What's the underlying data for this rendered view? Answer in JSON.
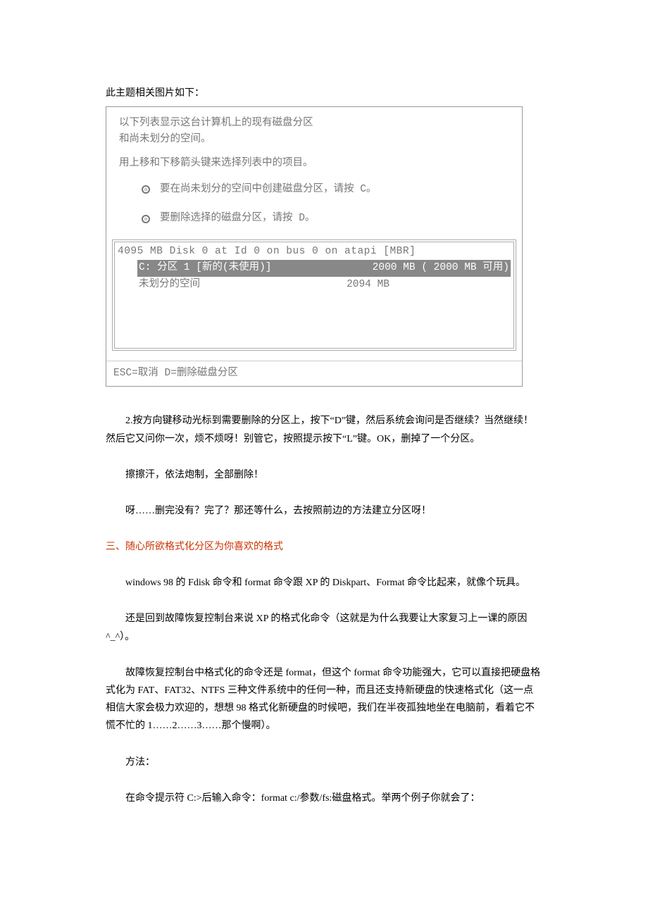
{
  "caption": "此主题相关图片如下：",
  "screenshot": {
    "intro_line1": "以下列表显示这台计算机上的现有磁盘分区",
    "intro_line2": "和尚未划分的空间。",
    "instruction": "用上移和下移箭头键来选择列表中的项目。",
    "bullets": [
      "要在尚未划分的空间中创建磁盘分区，请按 C。",
      "要删除选择的磁盘分区，请按 D。"
    ],
    "disk_header": "4095 MB Disk 0 at Id 0 on bus 0 on atapi [MBR]",
    "selected_left": "C:  分区 1 [新的(未使用)]",
    "selected_right": "2000 MB (  2000 MB 可用)",
    "free_left": "未划分的空间",
    "free_right": "2094 MB",
    "footer": "ESC=取消  D=删除磁盘分区"
  },
  "paragraphs": {
    "p1": "2.按方向键移动光标到需要删除的分区上，按下“D”键，然后系统会询问是否继续？当然继续！然后它又问你一次，烦不烦呀！别管它，按照提示按下“L”键。OK，删掉了一个分区。",
    "p2": "擦擦汗，依法炮制，全部删除！",
    "p3": "呀……删完没有？完了？那还等什么，去按照前边的方法建立分区呀！",
    "section": "三、随心所欲格式化分区为你喜欢的格式",
    "p4": "windows 98 的 Fdisk 命令和 format 命令跟 XP 的 Diskpart、Format 命令比起来，就像个玩具。",
    "p5": "还是回到故障恢复控制台来说 XP 的格式化命令（这就是为什么我要让大家复习上一课的原因^_^）。",
    "p6": "故障恢复控制台中格式化的命令还是 format，但这个 format 命令功能强大，它可以直接把硬盘格式化为 FAT、FAT32、NTFS 三种文件系统中的任何一种，而且还支持新硬盘的快速格式化（这一点相信大家会极力欢迎的，想想 98 格式化新硬盘的时候吧，我们在半夜孤独地坐在电脑前，看着它不慌不忙的 1……2……3……那个慢啊）。",
    "p7": "方法：",
    "p8": "在命令提示符 C:>后输入命令：format c:/参数/fs:磁盘格式。举两个例子你就会了："
  }
}
